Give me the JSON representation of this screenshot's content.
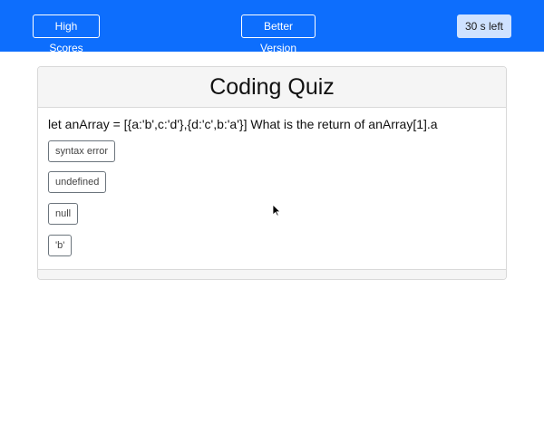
{
  "navbar": {
    "high_scores_label": "High Scores",
    "better_version_label": "Better Version",
    "timer_text": "30 s left",
    "background_color": "#0d6efd"
  },
  "quiz": {
    "title": "Coding Quiz",
    "question": "let anArray = [{a:'b',c:'d'},{d:'c',b:'a'}] What is the return of anArray[1].a",
    "answers": [
      "syntax error",
      "undefined",
      "null",
      "'b'"
    ]
  },
  "cursor_icon": "mouse-pointer-icon"
}
